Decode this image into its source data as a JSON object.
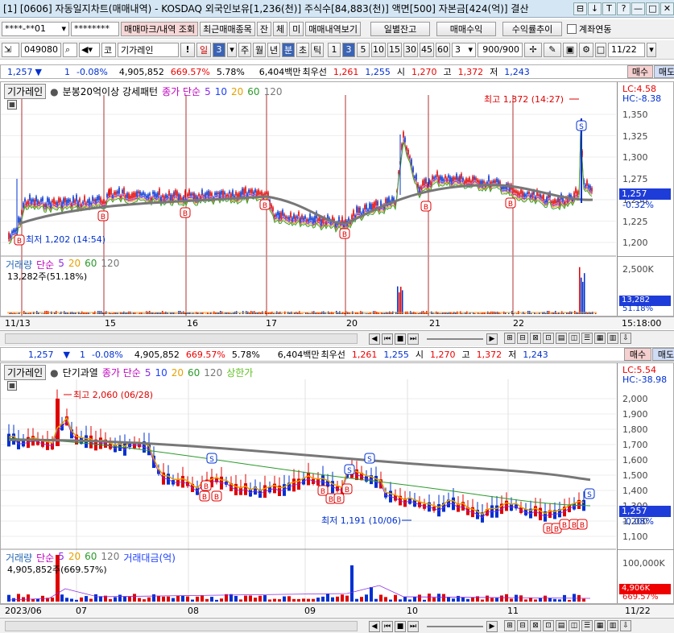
{
  "window": {
    "title": "[1] [0606] 자동일지차트(매매내역) - KOSDAQ 외국인보유[1,236(천)] 주식수[84,883(천)] 액면[500] 자본금[424(억)] 결산",
    "controls": [
      "⊟",
      "↓",
      "T",
      "?",
      "—",
      "□",
      "✕"
    ]
  },
  "toolbar1": {
    "account": "****-**01",
    "password": "********",
    "buttons": [
      "매매마크/내역 조회",
      "최근매매종목",
      "잔",
      "체",
      "미",
      "매매내역보기",
      "일별잔고",
      "매매수익",
      "수익률추이"
    ],
    "checkbox_label": "계좌연동"
  },
  "toolbar2": {
    "code": "049080",
    "chart_type": "코",
    "chart_name": "기가레인",
    "period_btn": "일",
    "period_num": "3",
    "periods": [
      "주",
      "월",
      "년",
      "분",
      "초",
      "틱",
      "1",
      "3",
      "5",
      "10",
      "15",
      "30",
      "45",
      "60"
    ],
    "interval": "3",
    "count": "900/900",
    "date": "11/22"
  },
  "info": {
    "price": "1,257",
    "change": "1",
    "pct": "-0.08%",
    "volume": "4,905,852",
    "vol_pct": "669.57%",
    "rate": "5.78%",
    "amount": "6,404백만",
    "best_label": "최우선",
    "best_sell": "1,261",
    "best_buy": "1,255",
    "open_label": "시",
    "open": "1,270",
    "high_label": "고",
    "high": "1,372",
    "low_label": "저",
    "low": "1,243",
    "buy": "매수",
    "sell": "매도"
  },
  "chart1": {
    "legend": {
      "name": "기가레인",
      "pattern": "분봉20억이상 강세패턴",
      "ma_label": "종가 단순",
      "ma": [
        "5",
        "10",
        "20",
        "60",
        "120"
      ]
    },
    "lc": "LC:4.58",
    "hc": "HC:-8.38",
    "yticks": [
      "1,350",
      "1,325",
      "1,300",
      "1,275",
      "1,250",
      "1,225",
      "1,200"
    ],
    "price_label": "1,257",
    "price_pct": "-0.32%",
    "high_note": "최고 1,372 (14:27)",
    "low_note": "최저 1,202 (14:54)",
    "volume": {
      "label": "거래량",
      "ma_label": "단순",
      "ma": [
        "5",
        "20",
        "60",
        "120"
      ],
      "value": "13,282주(51.18%)",
      "ytick": "2,500K",
      "cur": "13,282",
      "cur_pct": "51.18%"
    },
    "dates": [
      "11/13",
      "15",
      "16",
      "17",
      "20",
      "21",
      "22"
    ],
    "time": "15:18:00"
  },
  "chart2": {
    "legend": {
      "name": "기가레인",
      "pattern": "단기과열",
      "ma_label": "종가 단순",
      "ma": [
        "5",
        "10",
        "20",
        "60",
        "120"
      ],
      "limit": "상한가"
    },
    "lc": "LC:5.54",
    "hc": "HC:-38.98",
    "yticks": [
      "2,000",
      "1,900",
      "1,800",
      "1,700",
      "1,600",
      "1,500",
      "1,400",
      "1,300",
      "1,200",
      "1,100"
    ],
    "price_label": "1,257",
    "price_pct": "-0.08%",
    "high_note": "최고 2,060 (06/28)",
    "low_note": "최저 1,191 (10/06)",
    "volume": {
      "label": "거래량",
      "ma_label": "단순",
      "ma": [
        "5",
        "20",
        "60",
        "120"
      ],
      "amount_label": "거래대금(억)",
      "value": "4,905,852주(669.57%)",
      "ytick": "100,000K",
      "cur": "4,906K",
      "cur_pct": "669.57%"
    },
    "dates": [
      "2023/06",
      "07",
      "08",
      "09",
      "10",
      "11"
    ],
    "last_date": "11/22"
  },
  "colors": {
    "up": "#e00000",
    "down": "#0030d0",
    "ma5": "#8a2be2",
    "ma10": "#1e40ff",
    "ma20": "#e8a000",
    "ma60": "#2a9a2a",
    "ma120": "#777777"
  }
}
